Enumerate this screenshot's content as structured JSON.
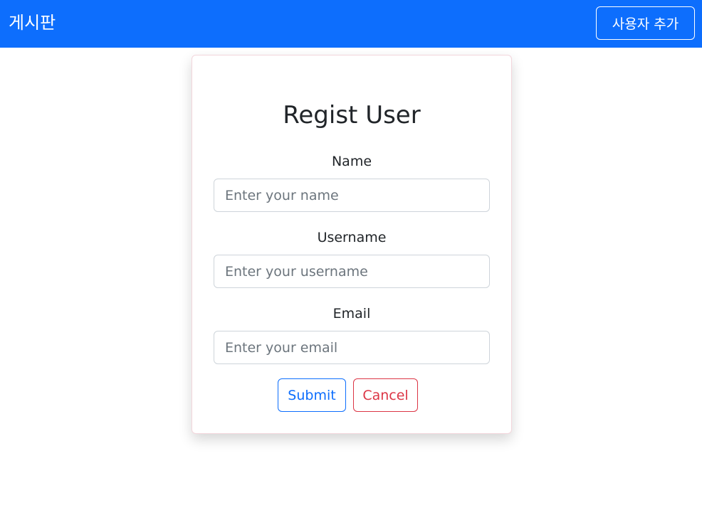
{
  "navbar": {
    "brand": "게시판",
    "add_user_label": "사용자 추가",
    "color": "#0d6efd"
  },
  "form": {
    "title": "Regist User",
    "fields": [
      {
        "label": "Name",
        "placeholder": "Enter your name",
        "value": ""
      },
      {
        "label": "Username",
        "placeholder": "Enter your username",
        "value": ""
      },
      {
        "label": "Email",
        "placeholder": "Enter your email",
        "value": ""
      }
    ],
    "submit_label": "Submit",
    "cancel_label": "Cancel",
    "submit_color": "#0d6efd",
    "cancel_color": "#dc3545"
  }
}
